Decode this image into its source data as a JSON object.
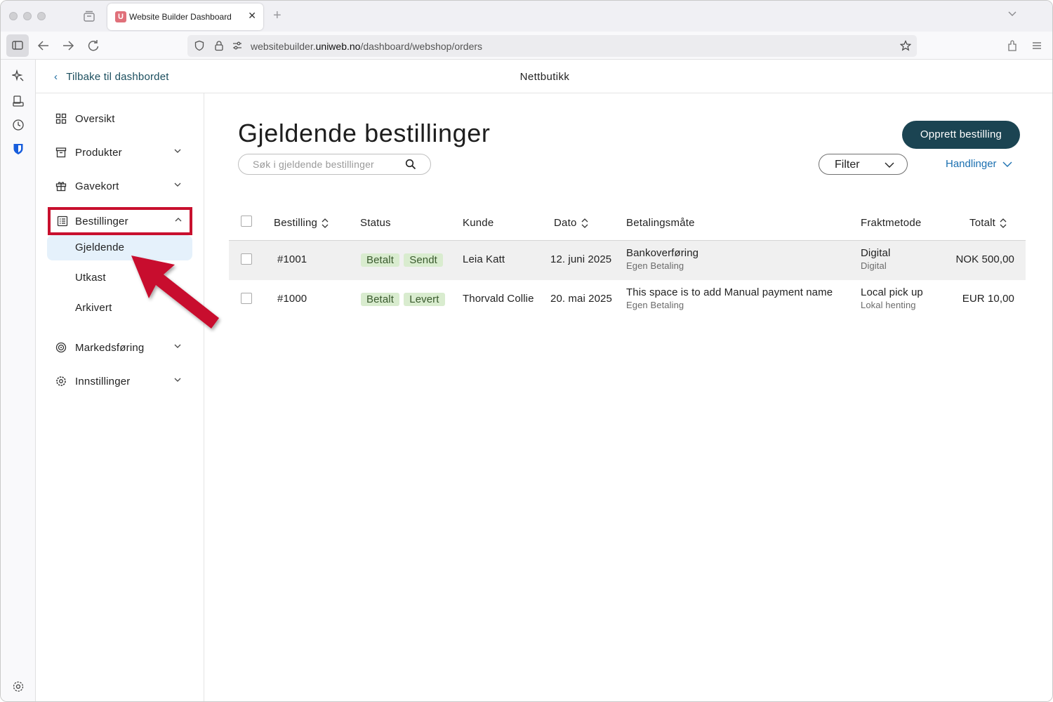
{
  "browser": {
    "tab_title": "Website Builder Dashboard",
    "tab_favicon_letter": "U",
    "url_prefix": "websitebuilder.",
    "url_domain": "uniweb.no",
    "url_path": "/dashboard/webshop/orders"
  },
  "header": {
    "back_label": "Tilbake til dashbordet",
    "title": "Nettbutikk"
  },
  "sidebar": {
    "items": [
      {
        "label": "Oversikt",
        "icon": "grid-icon"
      },
      {
        "label": "Produkter",
        "icon": "box-icon"
      },
      {
        "label": "Gavekort",
        "icon": "gift-icon"
      },
      {
        "label": "Bestillinger",
        "icon": "list-icon"
      },
      {
        "label": "Markedsføring",
        "icon": "target-icon"
      },
      {
        "label": "Innstillinger",
        "icon": "gear-icon"
      }
    ],
    "sub_items": [
      {
        "label": "Gjeldende"
      },
      {
        "label": "Utkast"
      },
      {
        "label": "Arkivert"
      }
    ]
  },
  "main": {
    "title": "Gjeldende bestillinger",
    "create_label": "Opprett bestilling",
    "search_placeholder": "Søk i gjeldende bestillinger",
    "filter_label": "Filter",
    "actions_label": "Handlinger"
  },
  "table": {
    "columns": [
      "Bestilling",
      "Status",
      "Kunde",
      "Dato",
      "Betalingsmåte",
      "Fraktmetode",
      "Totalt"
    ],
    "rows": [
      {
        "order": "#1001",
        "status": [
          "Betalt",
          "Sendt"
        ],
        "customer": "Leia Katt",
        "date": "12. juni 2025",
        "payment": "Bankoverføring",
        "payment_sub": "Egen Betaling",
        "shipping": "Digital",
        "shipping_sub": "Digital",
        "total": "NOK 500,00"
      },
      {
        "order": "#1000",
        "status": [
          "Betalt",
          "Levert"
        ],
        "customer": "Thorvald Collie",
        "date": "20. mai 2025",
        "payment": "This space is to add Manual payment name",
        "payment_sub": "Egen Betaling",
        "shipping": "Local pick up",
        "shipping_sub": "Lokal henting",
        "total": "EUR 10,00"
      }
    ]
  },
  "colors": {
    "primary_button": "#1b4452",
    "link": "#1a6fb0",
    "badge_bg": "#d9eccf",
    "highlight_outline": "#c8102e",
    "active_sub_bg": "#e5f1fb"
  }
}
